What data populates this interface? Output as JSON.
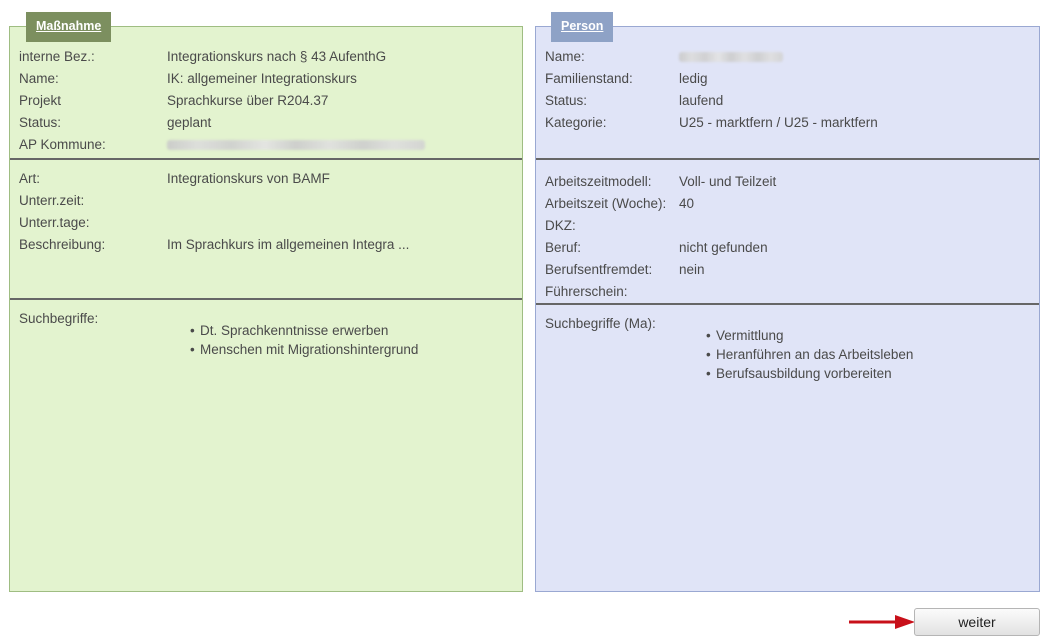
{
  "massnahme": {
    "tab_label": "Maßnahme",
    "fields_top": [
      {
        "label": "interne Bez.:",
        "value": "Integrationskurs nach § 43 AufenthG"
      },
      {
        "label": "Name:",
        "value": "IK: allgemeiner Integrationskurs"
      },
      {
        "label": "Projekt",
        "value": "Sprachkurse über R204.37"
      },
      {
        "label": "Status:",
        "value": "geplant"
      },
      {
        "label": "AP Kommune:",
        "value": ""
      }
    ],
    "fields_mid": [
      {
        "label": "Art:",
        "value": "Integrationskurs von BAMF"
      },
      {
        "label": "Unterr.zeit:",
        "value": ""
      },
      {
        "label": "Unterr.tage:",
        "value": ""
      },
      {
        "label": "Beschreibung:",
        "value": "Im Sprachkurs im allgemeinen Integra ..."
      }
    ],
    "suchbegriffe_label": "Suchbegriffe:",
    "suchbegriffe": [
      "Dt. Sprachkenntnisse erwerben",
      "Menschen mit Migrationshintergrund"
    ]
  },
  "person": {
    "tab_label": "Person",
    "fields_top": [
      {
        "label": "Name:",
        "value": ""
      },
      {
        "label": "Familienstand:",
        "value": "ledig"
      },
      {
        "label": "Status:",
        "value": "laufend"
      },
      {
        "label": "Kategorie:",
        "value": "U25 - marktfern / U25 - marktfern"
      }
    ],
    "fields_mid": [
      {
        "label": "Arbeitszeitmodell:",
        "value": "Voll- und Teilzeit"
      },
      {
        "label": "Arbeitszeit (Woche):",
        "value": "40"
      },
      {
        "label": "DKZ:",
        "value": ""
      },
      {
        "label": "Beruf:",
        "value": "nicht gefunden"
      },
      {
        "label": "Berufsentfremdet:",
        "value": "nein"
      },
      {
        "label": "Führerschein:",
        "value": ""
      }
    ],
    "suchbegriffe_label": "Suchbegriffe (Ma):",
    "suchbegriffe": [
      "Vermittlung",
      "Heranführen an das Arbeitsleben",
      "Berufsausbildung vorbereiten"
    ]
  },
  "footer": {
    "weiter_label": "weiter"
  },
  "colors": {
    "left_panel_bg": "#e3f3cf",
    "right_panel_bg": "#e0e4f7",
    "left_tab_bg": "#7c8f5f",
    "right_tab_bg": "#8ea2c6",
    "arrow": "#c8101a"
  },
  "icons": {
    "arrow": "arrow-right-icon"
  }
}
